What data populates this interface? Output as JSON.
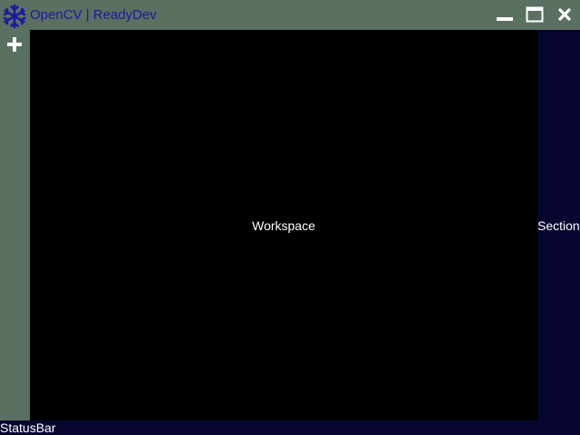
{
  "window": {
    "title": "OpenCV | ReadyDev",
    "app_icon": "snowflake-icon",
    "controls": {
      "minimize_icon": "minimize-icon",
      "maximize_icon": "maximize-icon",
      "close_icon": "close-icon"
    }
  },
  "toolbar": {
    "add_icon": "plus-icon"
  },
  "workspace": {
    "label": "Workspace"
  },
  "section": {
    "label": "Section"
  },
  "statusbar": {
    "label": "StatusBar"
  },
  "colors": {
    "chrome": "#5a7060",
    "title_text": "#1a1aa0",
    "workspace_bg": "#000000",
    "panel_bg": "#060630",
    "text": "#ffffff"
  }
}
